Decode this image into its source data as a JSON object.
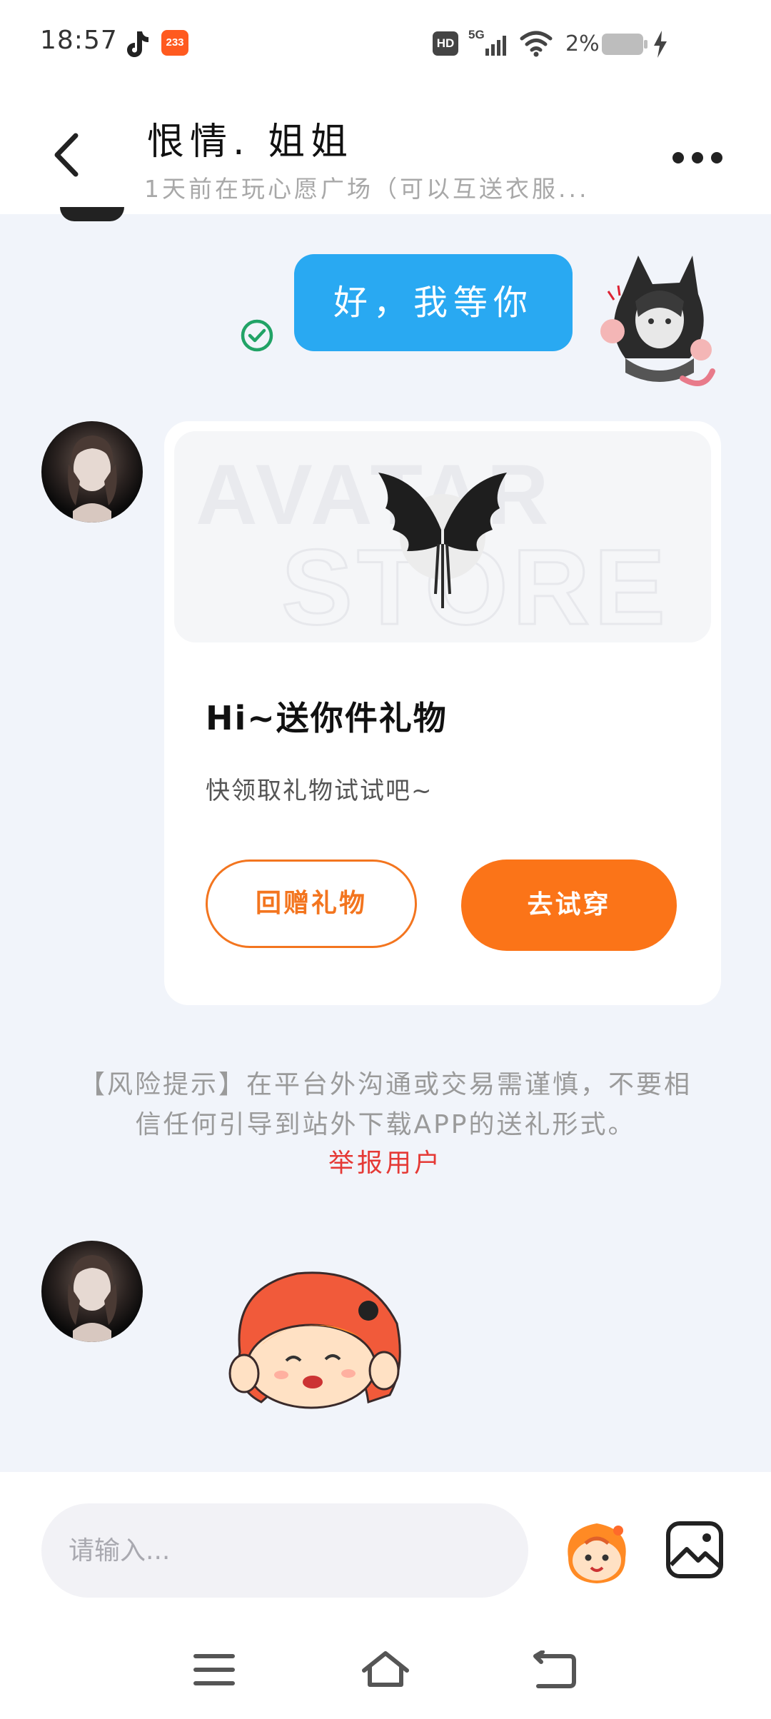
{
  "status_bar": {
    "time": "18:57",
    "app_icon_text": "233",
    "hd_label": "HD",
    "network_label": "5G",
    "battery_percent": "2%",
    "icons": [
      "tiktok-icon",
      "app-233-icon",
      "hd-icon",
      "signal-5g-icon",
      "wifi-icon",
      "battery-icon",
      "charging-icon"
    ]
  },
  "header": {
    "title": "恨情.  姐姐",
    "subtitle": "1天前在玩心愿广场（可以互送衣服...",
    "icons": [
      "back-arrow-icon",
      "more-dots-icon"
    ]
  },
  "messages": {
    "sent_text": "好，我等你",
    "sent_status_icon": "check-circle-icon",
    "gift_card": {
      "banner_text_line1": "AVATAR",
      "banner_text_line2": "STORE",
      "title": "Hi~送你件礼物",
      "subtitle": "快领取礼物试试吧~",
      "return_gift_label": "回赠礼物",
      "try_on_label": "去试穿",
      "accent_color": "#fb7418"
    },
    "risk_notice": "【风险提示】在平台外沟通或交易需谨慎，不要相信任何引导到站外下载APP的送礼形式。",
    "report_label": "举报用户"
  },
  "input_bar": {
    "placeholder": "请输入...",
    "icons": [
      "emoji-sticker-icon",
      "image-icon"
    ]
  },
  "nav_bar": {
    "icons": [
      "menu-lines-icon",
      "home-icon",
      "back-return-icon"
    ]
  },
  "colors": {
    "sent_bubble": "#29a9f2",
    "check": "#21a366",
    "report": "#e53935",
    "background": "#f1f4fa"
  }
}
